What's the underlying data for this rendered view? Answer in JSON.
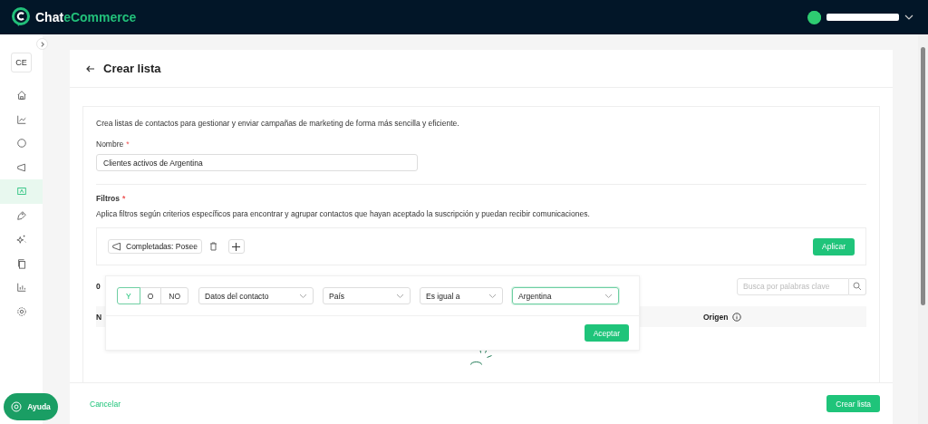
{
  "topbar": {
    "brand": [
      "Chat",
      "eCommerce"
    ]
  },
  "sidebar": {
    "badge": "CE",
    "items": [
      {
        "selected": false
      },
      {
        "selected": false
      },
      {
        "selected": false
      },
      {
        "selected": false
      },
      {
        "selected": true
      },
      {
        "selected": false
      },
      {
        "selected": false
      },
      {
        "selected": false
      },
      {
        "selected": false
      },
      {
        "selected": false
      }
    ]
  },
  "page": {
    "title": "Crear lista",
    "intro": "Crea listas de contactos para gestionar y enviar campañas de marketing de forma más sencilla y eficiente.",
    "name_label": "Nombre",
    "name_required": "*",
    "name_value": "Clientes activos de Argentina",
    "filters_label": "Filtros",
    "filters_required": "*",
    "filters_description": "Aplica filtros según criterios específicos para encontrar y agrupar contactos que hayan aceptado la suscripción y puedan recibir comunicaciones.",
    "chips": [
      {
        "label": "Completadas: Posee"
      }
    ],
    "apply": "Aplicar",
    "result_count": "0",
    "search_placeholder": "Busca por palabras clave",
    "table_columns": [
      "N",
      "Origen"
    ]
  },
  "filter_popup": {
    "logic": [
      {
        "label": "Y",
        "selected": true
      },
      {
        "label": "O",
        "selected": false
      },
      {
        "label": "NO",
        "selected": false
      }
    ],
    "selects": [
      {
        "value": "Datos del contacto",
        "focused": false
      },
      {
        "value": "País",
        "focused": false
      },
      {
        "value": "Es igual a",
        "focused": false
      },
      {
        "value": "Argentina",
        "focused": true
      }
    ],
    "accept": "Aceptar"
  },
  "footer": {
    "cancel": "Cancelar",
    "submit": "Crear lista"
  },
  "help": "Ayuda"
}
